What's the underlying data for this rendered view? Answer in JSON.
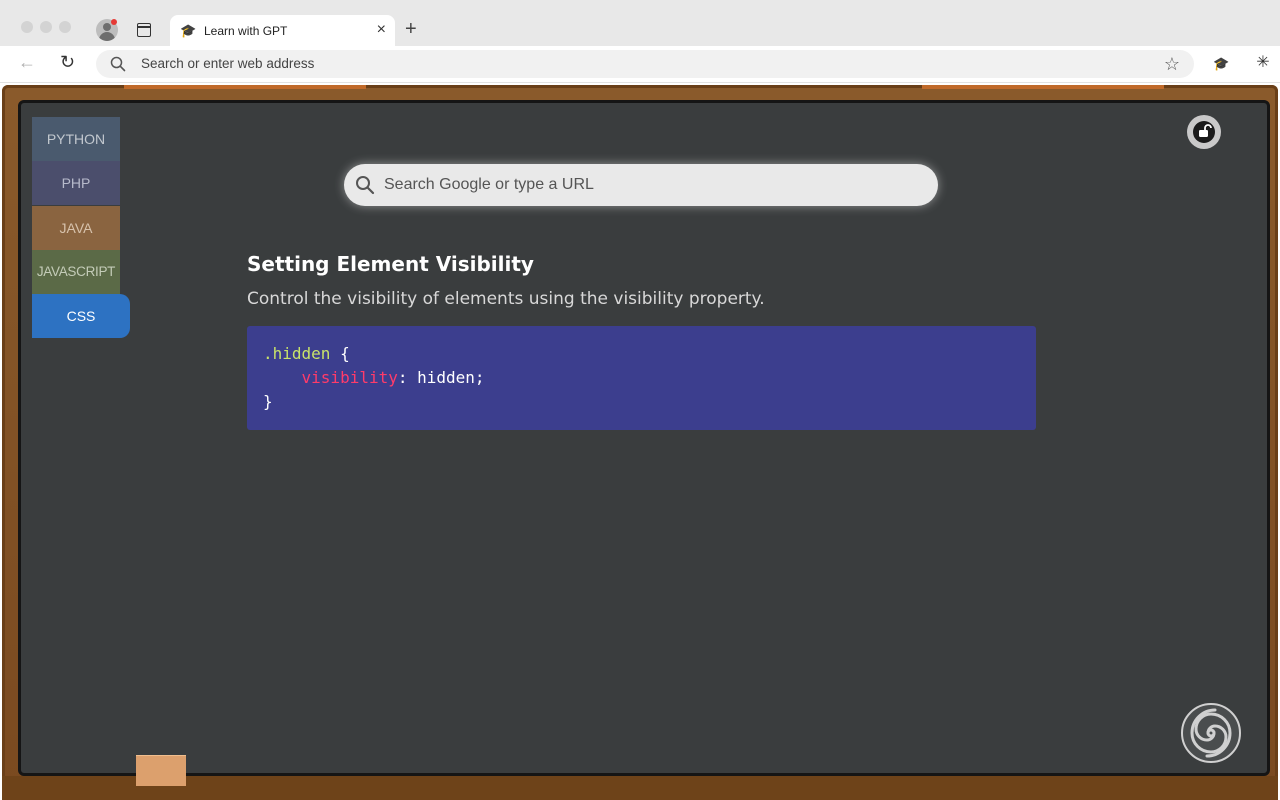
{
  "browser": {
    "tab_title": "Learn with GPT",
    "tab_close": "×",
    "new_tab": "+",
    "address_placeholder": "Search or enter web address",
    "tab_favicon": "🎓",
    "star": "☆",
    "ext_gpt_icon": "🎓",
    "ext_puzzle_icon": "✳",
    "back_icon": "←",
    "reload_icon": "↻"
  },
  "sidebar": {
    "items": [
      {
        "label": "PYTHON"
      },
      {
        "label": "PHP"
      },
      {
        "label": "JAVA"
      },
      {
        "label": "JAVASCRIPT"
      },
      {
        "label": "CSS",
        "active": true
      }
    ]
  },
  "search": {
    "placeholder": "Search Google or type a URL"
  },
  "lesson": {
    "title": "Setting Element Visibility",
    "description": "Control the visibility of elements using the visibility property.",
    "code": {
      "selector": ".hidden",
      "open_brace": " {",
      "indent": "    ",
      "property": "visibility",
      "value": ": hidden;",
      "close_brace": "}"
    }
  },
  "colors": {
    "board": "#3a3d3e",
    "frame": "#8a5a2b",
    "active_tab": "#2d72c2",
    "code_bg": "#3c3e8e"
  }
}
